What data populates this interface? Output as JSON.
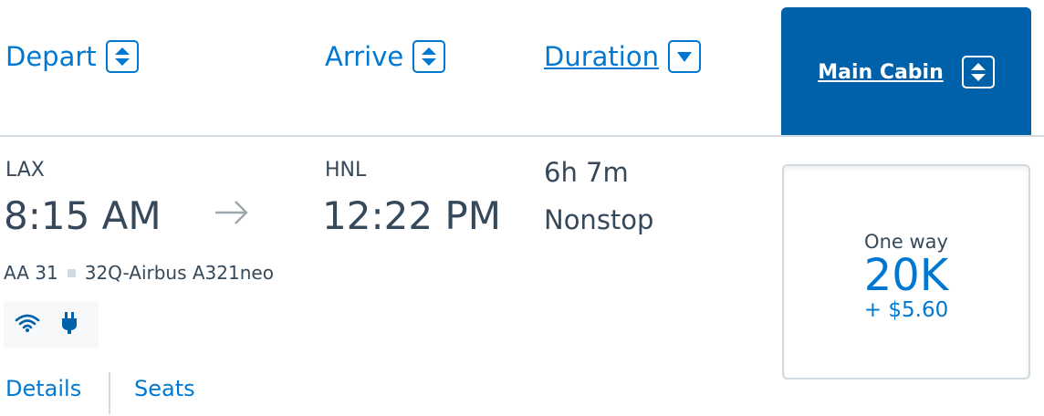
{
  "headers": {
    "depart": "Depart",
    "arrive": "Arrive",
    "duration": "Duration",
    "cabin": "Main Cabin"
  },
  "flight": {
    "origin_code": "LAX",
    "depart_time": "8:15 AM",
    "dest_code": "HNL",
    "arrive_time": "12:22 PM",
    "flight_number": "AA 31",
    "aircraft": "32Q-Airbus A321neo",
    "amenities": [
      "wifi-icon",
      "power-outlet-icon"
    ],
    "duration": "6h 7m",
    "stops": "Nonstop"
  },
  "links": {
    "details": "Details",
    "seats": "Seats"
  },
  "fare": {
    "label": "One way",
    "miles": "20K",
    "tax": "+ $5.60"
  },
  "colors": {
    "accent": "#0078d2",
    "cabin_header_bg": "#0061ab",
    "text": "#36495a",
    "divider": "#d0dae0"
  }
}
